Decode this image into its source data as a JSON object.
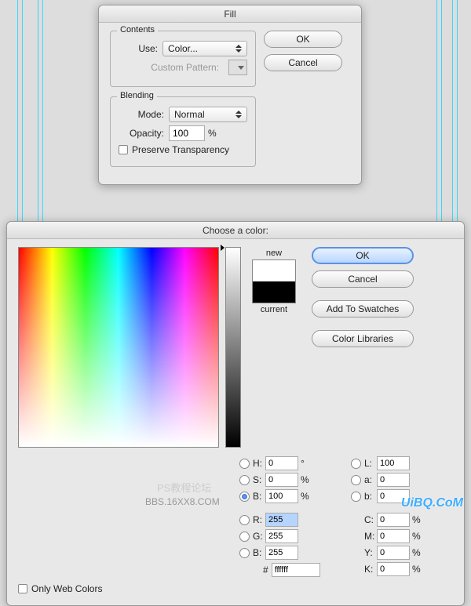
{
  "guides": [
    22,
    28,
    48,
    54,
    556,
    562,
    576,
    582
  ],
  "fill": {
    "title": "Fill",
    "contents": {
      "legend": "Contents",
      "use_label": "Use:",
      "use_value": "Color...",
      "pattern_label": "Custom Pattern:"
    },
    "blending": {
      "legend": "Blending",
      "mode_label": "Mode:",
      "mode_value": "Normal",
      "opacity_label": "Opacity:",
      "opacity_value": "100",
      "opacity_unit": "%",
      "preserve_label": "Preserve Transparency"
    },
    "ok": "OK",
    "cancel": "Cancel"
  },
  "picker": {
    "title": "Choose a color:",
    "new_label": "new",
    "current_label": "current",
    "new_color": "#ffffff",
    "current_color": "#000000",
    "ok": "OK",
    "cancel": "Cancel",
    "add_swatches": "Add To Swatches",
    "color_libraries": "Color Libraries",
    "only_web": "Only Web Colors",
    "hsb": {
      "h": {
        "label": "H:",
        "value": "0",
        "unit": "°"
      },
      "s": {
        "label": "S:",
        "value": "0",
        "unit": "%"
      },
      "b": {
        "label": "B:",
        "value": "100",
        "unit": "%"
      }
    },
    "lab": {
      "l": {
        "label": "L:",
        "value": "100"
      },
      "a": {
        "label": "a:",
        "value": "0"
      },
      "b": {
        "label": "b:",
        "value": "0"
      }
    },
    "rgb": {
      "r": {
        "label": "R:",
        "value": "255"
      },
      "g": {
        "label": "G:",
        "value": "255"
      },
      "b": {
        "label": "B:",
        "value": "255"
      }
    },
    "cmyk": {
      "c": {
        "label": "C:",
        "value": "0",
        "unit": "%"
      },
      "m": {
        "label": "M:",
        "value": "0",
        "unit": "%"
      },
      "y": {
        "label": "Y:",
        "value": "0",
        "unit": "%"
      },
      "k": {
        "label": "K:",
        "value": "0",
        "unit": "%"
      }
    },
    "hex_label": "#",
    "hex_value": "ffffff"
  },
  "watermarks": {
    "main": "UiBQ.CoM",
    "t2": "PS教程论坛",
    "t3": "BBS.16XX8.COM"
  }
}
